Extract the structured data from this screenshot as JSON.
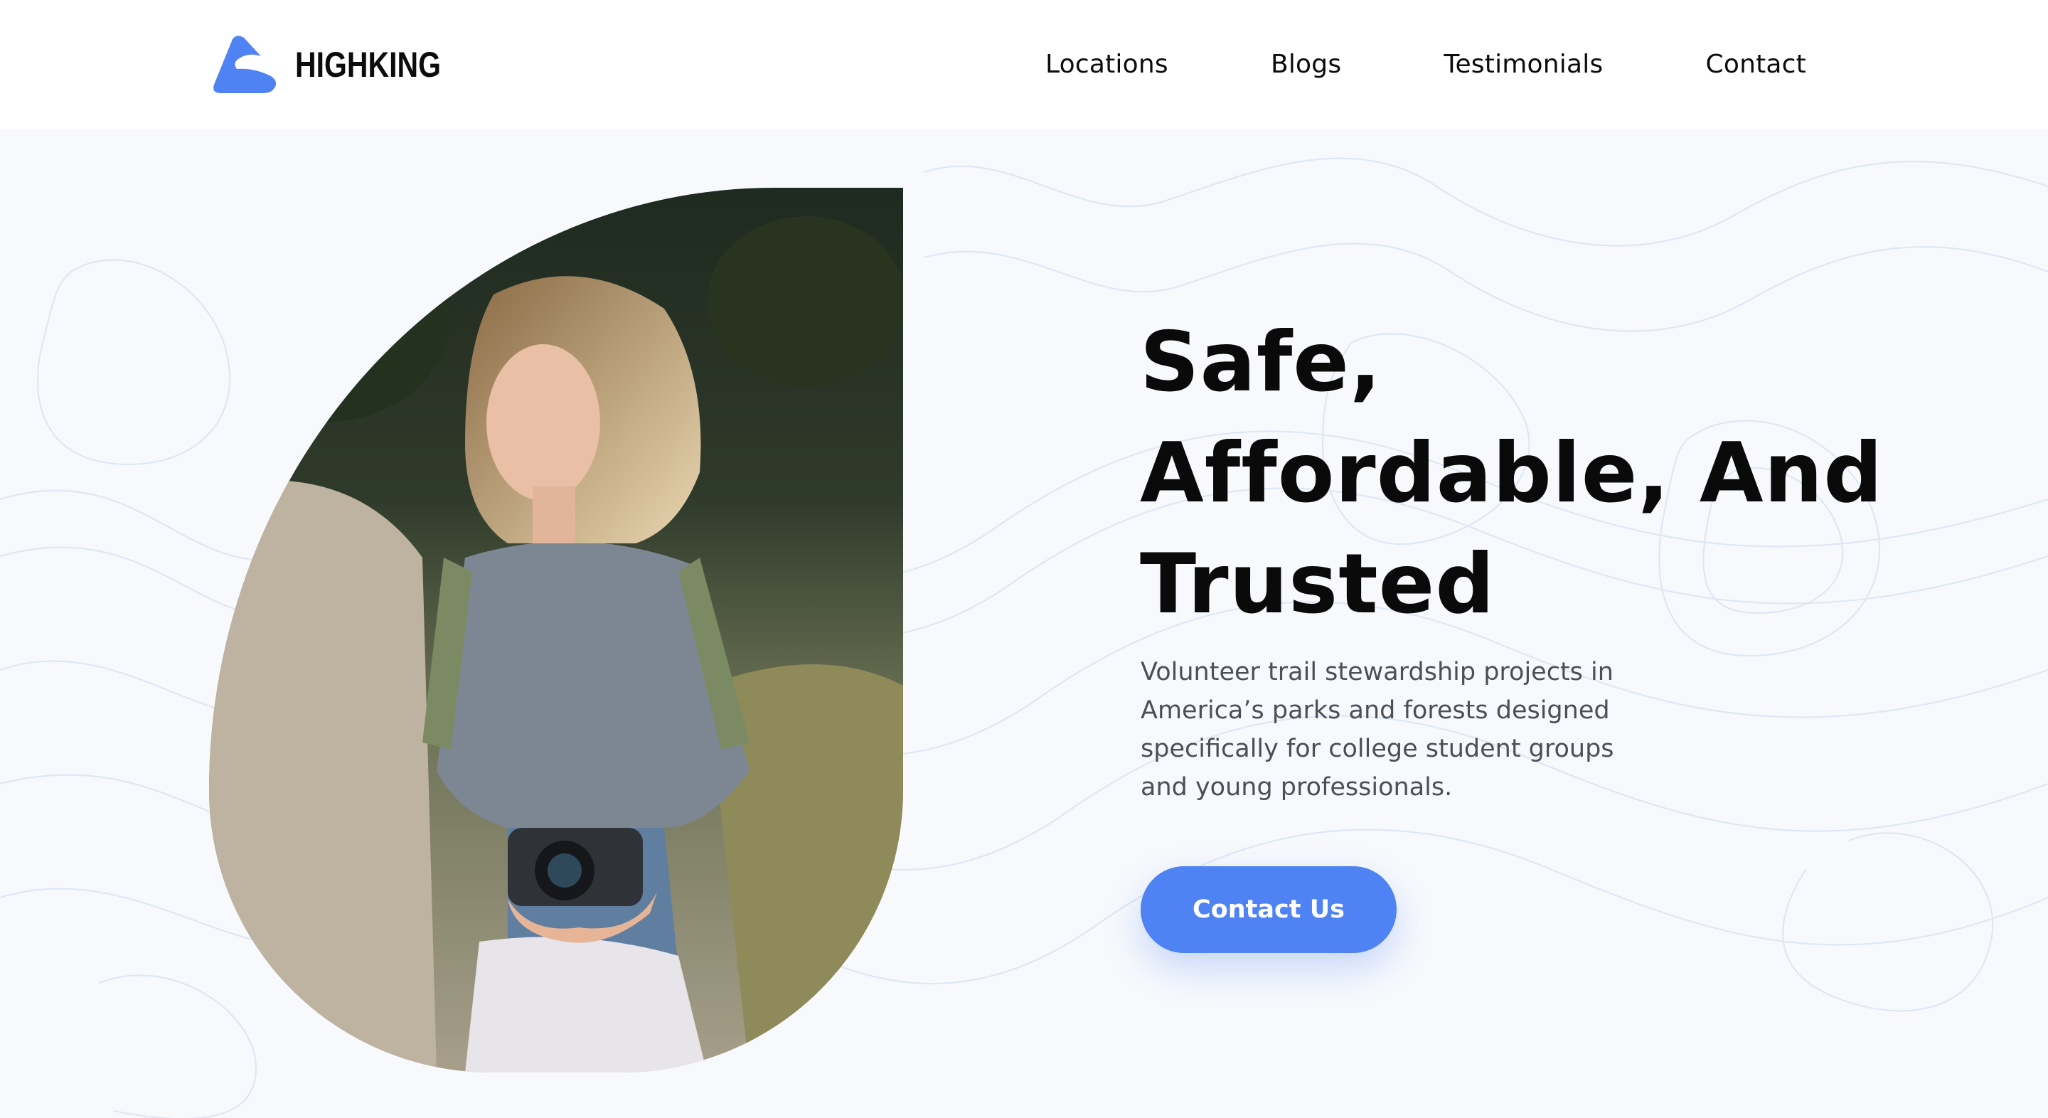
{
  "brand": {
    "name": "HIGHKING",
    "accent": "#4f83f3"
  },
  "nav": {
    "items": [
      {
        "label": "Locations"
      },
      {
        "label": "Blogs"
      },
      {
        "label": "Testimonials"
      },
      {
        "label": "Contact"
      }
    ]
  },
  "hero": {
    "headline_lines": [
      "Safe,",
      "Affordable, And",
      "Trusted"
    ],
    "description_lines": [
      "Volunteer trail stewardship projects in",
      "America’s parks and forests designed",
      "specifically for college student groups",
      "and young professionals."
    ],
    "cta_label": "Contact Us"
  }
}
